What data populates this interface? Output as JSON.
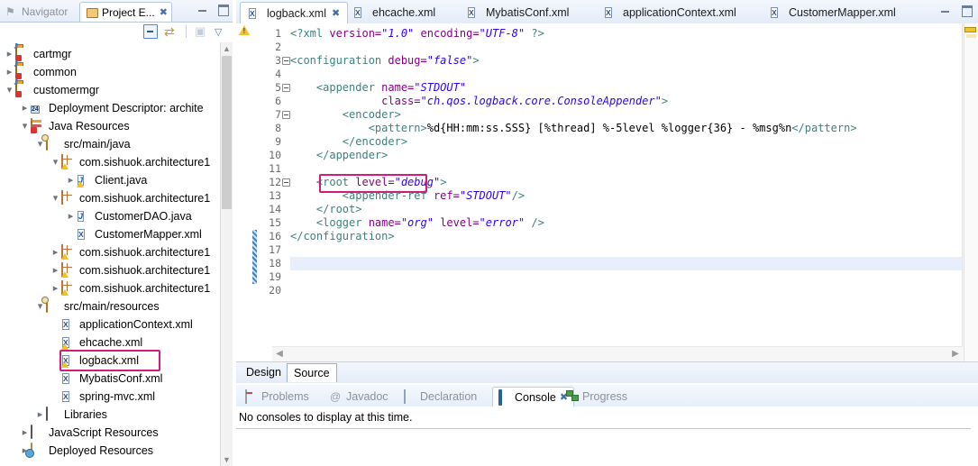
{
  "left_view": {
    "tabs": [
      {
        "label": "Navigator",
        "icon": "navigator-icon",
        "active": false
      },
      {
        "label": "Project E...",
        "icon": "project-explorer-icon",
        "active": true,
        "close": "✖"
      }
    ],
    "window_buttons": [
      "minimize",
      "maximize"
    ],
    "toolbar_icons": [
      "collapse-all-icon",
      "link-with-editor-icon",
      "view-menu-icon",
      "view-dropdown-icon"
    ],
    "tree": [
      {
        "depth": 0,
        "arrow": "right",
        "icon": "java-project-icon",
        "label": "cartmgr"
      },
      {
        "depth": 0,
        "arrow": "right",
        "icon": "java-project-icon",
        "label": "common"
      },
      {
        "depth": 0,
        "arrow": "down",
        "icon": "java-project-icon",
        "label": "customermgr"
      },
      {
        "depth": 1,
        "arrow": "right",
        "icon": "deployment-descriptor-icon",
        "label": "Deployment Descriptor: archite"
      },
      {
        "depth": 1,
        "arrow": "down",
        "icon": "java-resources-icon",
        "label": "Java Resources"
      },
      {
        "depth": 2,
        "arrow": "down",
        "icon": "source-folder-icon",
        "label": "src/main/java"
      },
      {
        "depth": 3,
        "arrow": "down",
        "icon": "package-warning-icon",
        "label": "com.sishuok.architecture1"
      },
      {
        "depth": 4,
        "arrow": "right",
        "icon": "java-file-warning-icon",
        "label": "Client.java"
      },
      {
        "depth": 3,
        "arrow": "down",
        "icon": "package-icon",
        "label": "com.sishuok.architecture1"
      },
      {
        "depth": 4,
        "arrow": "right",
        "icon": "java-file-icon",
        "label": "CustomerDAO.java"
      },
      {
        "depth": 4,
        "arrow": "none",
        "icon": "xml-file-icon",
        "label": "CustomerMapper.xml"
      },
      {
        "depth": 3,
        "arrow": "right",
        "icon": "package-warning-icon",
        "label": "com.sishuok.architecture1"
      },
      {
        "depth": 3,
        "arrow": "right",
        "icon": "package-warning-icon",
        "label": "com.sishuok.architecture1"
      },
      {
        "depth": 3,
        "arrow": "right",
        "icon": "package-warning-icon",
        "label": "com.sishuok.architecture1"
      },
      {
        "depth": 2,
        "arrow": "down",
        "icon": "source-folder-icon",
        "label": "src/main/resources"
      },
      {
        "depth": 3,
        "arrow": "none",
        "icon": "xml-file-icon",
        "label": "applicationContext.xml"
      },
      {
        "depth": 3,
        "arrow": "none",
        "icon": "xml-file-warning-icon",
        "label": "ehcache.xml"
      },
      {
        "depth": 3,
        "arrow": "none",
        "icon": "xml-file-warning-icon",
        "label": "logback.xml",
        "highlighted": true
      },
      {
        "depth": 3,
        "arrow": "none",
        "icon": "xml-file-icon",
        "label": "MybatisConf.xml"
      },
      {
        "depth": 3,
        "arrow": "none",
        "icon": "xml-file-icon",
        "label": "spring-mvc.xml"
      },
      {
        "depth": 2,
        "arrow": "right",
        "icon": "libraries-icon",
        "label": "Libraries"
      },
      {
        "depth": 1,
        "arrow": "right",
        "icon": "libraries-icon",
        "label": "JavaScript Resources"
      },
      {
        "depth": 1,
        "arrow": "right",
        "icon": "deployed-resources-icon",
        "label": "Deployed Resources"
      }
    ]
  },
  "editor": {
    "tabs": [
      {
        "label": "logback.xml",
        "icon": "xml-file-icon",
        "active": true,
        "close": "✖"
      },
      {
        "label": "ehcache.xml",
        "icon": "xml-file-icon",
        "active": false
      },
      {
        "label": "MybatisConf.xml",
        "icon": "xml-file-icon",
        "active": false
      },
      {
        "label": "applicationContext.xml",
        "icon": "xml-file-icon",
        "active": false
      },
      {
        "label": "CustomerMapper.xml",
        "icon": "xml-file-icon",
        "active": false
      }
    ],
    "window_buttons": [
      "minimize",
      "maximize"
    ],
    "line_numbers": [
      1,
      2,
      3,
      4,
      5,
      6,
      7,
      8,
      9,
      10,
      11,
      12,
      13,
      14,
      15,
      16,
      17,
      18,
      19,
      20
    ],
    "current_line": 18,
    "changed_lines": [
      16,
      17,
      18,
      19
    ],
    "fold_lines": [
      3,
      5,
      7,
      12
    ],
    "warning_line": 1,
    "highlight_box_line": 12,
    "code": [
      {
        "n": 1,
        "segments": [
          {
            "t": "<?xml ",
            "c": "pi"
          },
          {
            "t": "version=",
            "c": "attr"
          },
          {
            "t": "\"1.0\"",
            "c": "val"
          },
          {
            "t": " ",
            "c": "txt"
          },
          {
            "t": "encoding=",
            "c": "attr"
          },
          {
            "t": "\"UTF-8\"",
            "c": "val"
          },
          {
            "t": " ?>",
            "c": "pi"
          }
        ]
      },
      {
        "n": 2,
        "segments": []
      },
      {
        "n": 3,
        "segments": [
          {
            "t": "<configuration ",
            "c": "tag"
          },
          {
            "t": "debug=",
            "c": "attr"
          },
          {
            "t": "\"false\"",
            "c": "val"
          },
          {
            "t": ">",
            "c": "tag"
          }
        ]
      },
      {
        "n": 4,
        "segments": []
      },
      {
        "n": 5,
        "segments": [
          {
            "t": "    <appender ",
            "c": "tag"
          },
          {
            "t": "name=",
            "c": "attr"
          },
          {
            "t": "\"STDOUT\"",
            "c": "val"
          }
        ]
      },
      {
        "n": 6,
        "segments": [
          {
            "t": "              ",
            "c": "txt"
          },
          {
            "t": "class=",
            "c": "attr"
          },
          {
            "t": "\"ch.qos.logback.core.ConsoleAppender\"",
            "c": "val"
          },
          {
            "t": ">",
            "c": "tag"
          }
        ]
      },
      {
        "n": 7,
        "segments": [
          {
            "t": "        <encoder>",
            "c": "tag"
          }
        ]
      },
      {
        "n": 8,
        "segments": [
          {
            "t": "            <pattern>",
            "c": "tag"
          },
          {
            "t": "%d{HH:mm:ss.SSS} [%thread] %-5level %logger{36} - %msg%n",
            "c": "txt"
          },
          {
            "t": "</pattern>",
            "c": "tag"
          }
        ]
      },
      {
        "n": 9,
        "segments": [
          {
            "t": "        </encoder>",
            "c": "tag"
          }
        ]
      },
      {
        "n": 10,
        "segments": [
          {
            "t": "    </appender>",
            "c": "tag"
          }
        ]
      },
      {
        "n": 11,
        "segments": []
      },
      {
        "n": 12,
        "segments": [
          {
            "t": "    <root ",
            "c": "tag"
          },
          {
            "t": "level=",
            "c": "attr"
          },
          {
            "t": "\"debug\"",
            "c": "val"
          },
          {
            "t": ">",
            "c": "tag"
          }
        ]
      },
      {
        "n": 13,
        "segments": [
          {
            "t": "        <appender-ref ",
            "c": "tag"
          },
          {
            "t": "ref=",
            "c": "attr"
          },
          {
            "t": "\"STDOUT\"",
            "c": "val"
          },
          {
            "t": "/>",
            "c": "tag"
          }
        ]
      },
      {
        "n": 14,
        "segments": [
          {
            "t": "    </root>",
            "c": "tag"
          }
        ]
      },
      {
        "n": 15,
        "segments": [
          {
            "t": "    <logger ",
            "c": "tag"
          },
          {
            "t": "name=",
            "c": "attr"
          },
          {
            "t": "\"org\"",
            "c": "val"
          },
          {
            "t": " ",
            "c": "txt"
          },
          {
            "t": "level=",
            "c": "attr"
          },
          {
            "t": "\"error\"",
            "c": "val"
          },
          {
            "t": " />",
            "c": "tag"
          }
        ]
      },
      {
        "n": 16,
        "segments": [
          {
            "t": "</configuration>",
            "c": "tag"
          }
        ]
      },
      {
        "n": 17,
        "segments": []
      },
      {
        "n": 18,
        "segments": []
      },
      {
        "n": 19,
        "segments": []
      },
      {
        "n": 20,
        "segments": []
      }
    ],
    "design_source_tabs": [
      {
        "label": "Design",
        "active": false
      },
      {
        "label": "Source",
        "active": true
      }
    ]
  },
  "bottom_view": {
    "tabs": [
      {
        "label": "Problems",
        "icon": "problems-icon",
        "active": false
      },
      {
        "label": "Javadoc",
        "icon": "javadoc-icon",
        "active": false
      },
      {
        "label": "Declaration",
        "icon": "declaration-icon",
        "active": false
      },
      {
        "label": "Console",
        "icon": "console-icon",
        "active": true,
        "close": "✖"
      },
      {
        "label": "Progress",
        "icon": "progress-icon",
        "active": false
      }
    ],
    "message": "No consoles to display at this time."
  },
  "colors": {
    "highlight_box": "#cf1d7a",
    "tag": "#3f7f7f",
    "attribute": "#7f007f",
    "value": "#2a00ff",
    "current_line": "#e8eefb",
    "change_bar": "#3f7fbf"
  }
}
